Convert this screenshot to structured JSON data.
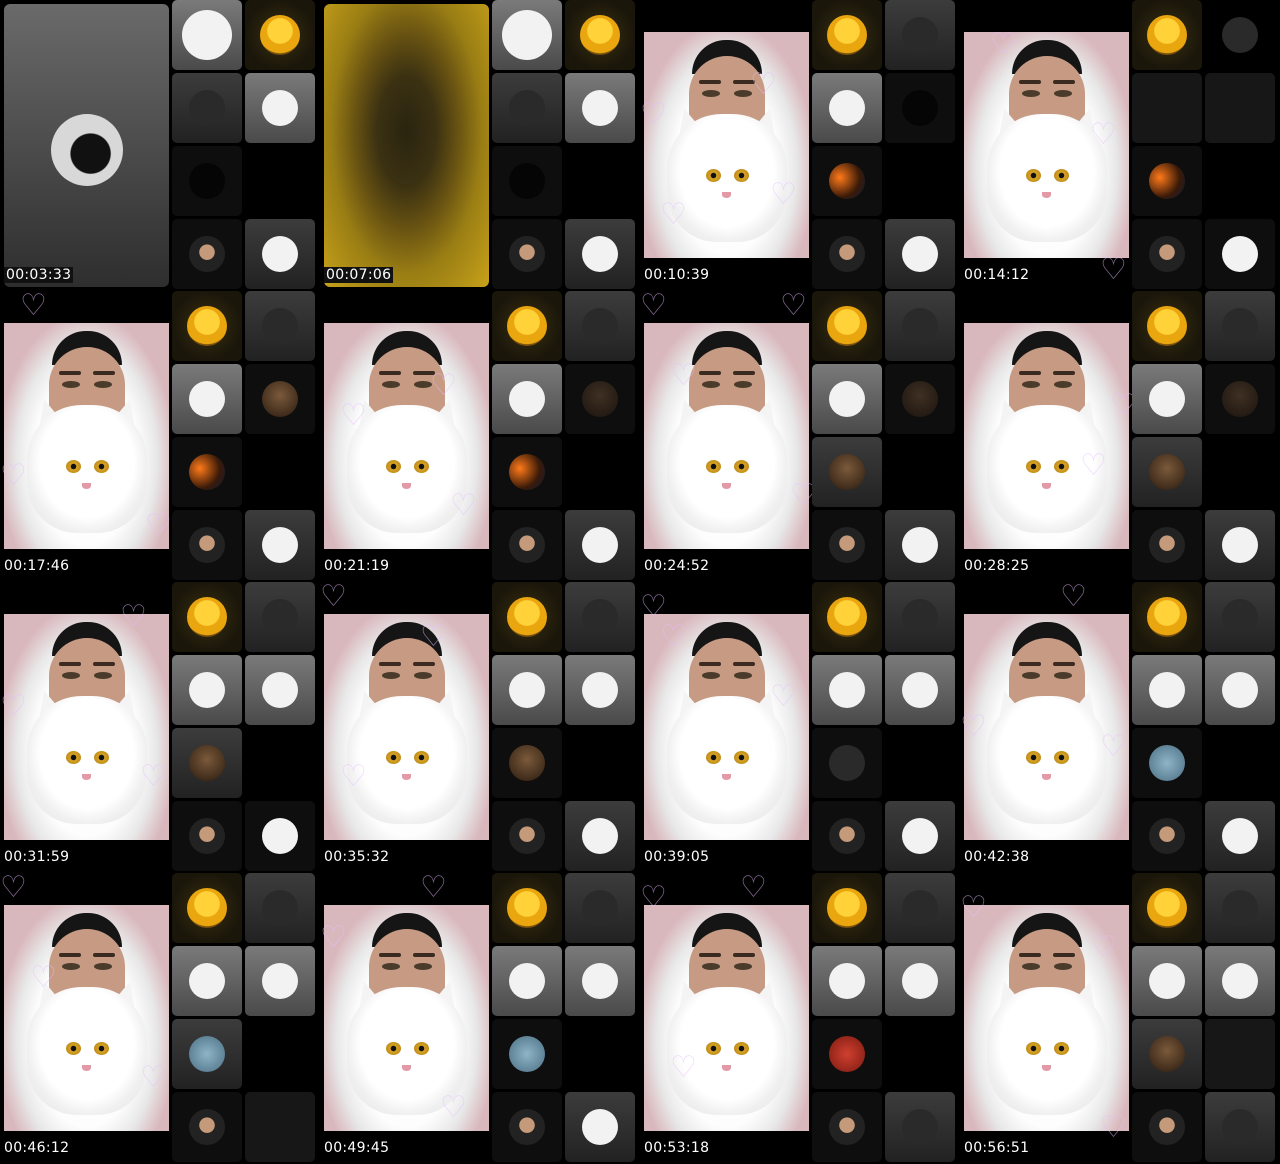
{
  "frames": [
    {
      "timestamp": "00:03:33",
      "main": "gray"
    },
    {
      "timestamp": "00:07:06",
      "main": "gold"
    },
    {
      "timestamp": "00:10:39",
      "main": "portrait"
    },
    {
      "timestamp": "00:14:12",
      "main": "portrait"
    },
    {
      "timestamp": "00:17:46",
      "main": "portrait"
    },
    {
      "timestamp": "00:21:19",
      "main": "portrait"
    },
    {
      "timestamp": "00:24:52",
      "main": "portrait"
    },
    {
      "timestamp": "00:28:25",
      "main": "portrait"
    },
    {
      "timestamp": "00:31:59",
      "main": "portrait"
    },
    {
      "timestamp": "00:35:32",
      "main": "portrait"
    },
    {
      "timestamp": "00:39:05",
      "main": "portrait"
    },
    {
      "timestamp": "00:42:38",
      "main": "portrait"
    },
    {
      "timestamp": "00:46:12",
      "main": "portrait"
    },
    {
      "timestamp": "00:49:45",
      "main": "portrait"
    },
    {
      "timestamp": "00:53:18",
      "main": "portrait"
    },
    {
      "timestamp": "00:56:51",
      "main": "portrait"
    }
  ],
  "colors": {
    "background": "#000000",
    "timestamp_text": "#ffffff",
    "portrait_bg": "#d9b8bd"
  }
}
